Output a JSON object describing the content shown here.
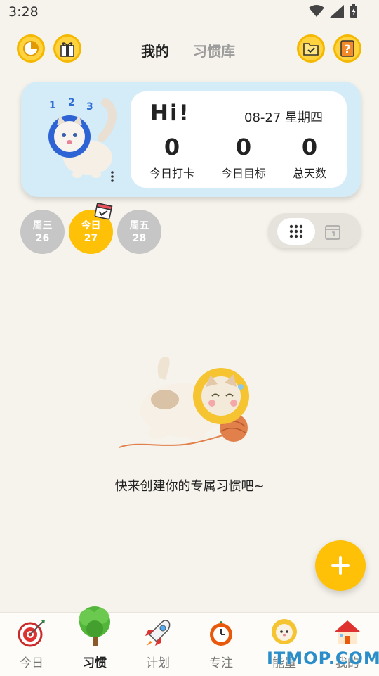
{
  "status_bar": {
    "time": "3:28"
  },
  "header": {
    "tabs": [
      {
        "label": "我的",
        "active": true
      },
      {
        "label": "习惯库",
        "active": false
      }
    ]
  },
  "profile": {
    "greeting": "Hi!",
    "date": "08-27 星期四",
    "stats": [
      {
        "value": "0",
        "label": "今日打卡"
      },
      {
        "value": "0",
        "label": "今日目标"
      },
      {
        "value": "0",
        "label": "总天数"
      }
    ],
    "badge_numbers": [
      "1",
      "2",
      "3"
    ]
  },
  "days": [
    {
      "name": "周三",
      "date": "26",
      "today": false
    },
    {
      "name": "今日",
      "date": "27",
      "today": true
    },
    {
      "name": "周五",
      "date": "28",
      "today": false
    }
  ],
  "empty_state": {
    "message": "快来创建你的专属习惯吧~"
  },
  "bottom_nav": [
    {
      "label": "今日",
      "icon": "target-icon",
      "active": false
    },
    {
      "label": "习惯",
      "icon": "tree-icon",
      "active": true
    },
    {
      "label": "计划",
      "icon": "rocket-icon",
      "active": false
    },
    {
      "label": "专注",
      "icon": "alarm-clock-icon",
      "active": false
    },
    {
      "label": "能量",
      "icon": "lion-cat-icon",
      "active": false
    },
    {
      "label": "我的",
      "icon": "house-icon",
      "active": false
    }
  ],
  "watermark": "ITMOP.COM",
  "colors": {
    "accent": "#ffc107",
    "card_bg": "#d4ebf8",
    "page_bg": "#f6f3ec"
  }
}
